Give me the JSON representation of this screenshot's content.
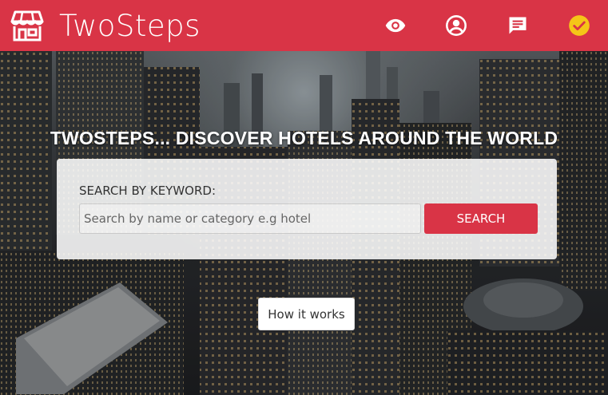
{
  "header": {
    "brand_title": "TwoSteps",
    "logo_icon": "storefront-icon",
    "nav_icons": [
      "eye-icon",
      "account-circle-icon",
      "message-icon",
      "check-circle-icon"
    ]
  },
  "hero": {
    "heading": "TWOSTEPS... DISCOVER HOTELS AROUND THE WORLD",
    "search_label": "SEARCH BY KEYWORD:",
    "search_placeholder": "Search by name or category e.g hotel",
    "search_value": "",
    "search_button": "SEARCH",
    "how_it_works_button": "How it works"
  },
  "colors": {
    "brand": "#d93446",
    "check_badge": "#f5c518"
  }
}
